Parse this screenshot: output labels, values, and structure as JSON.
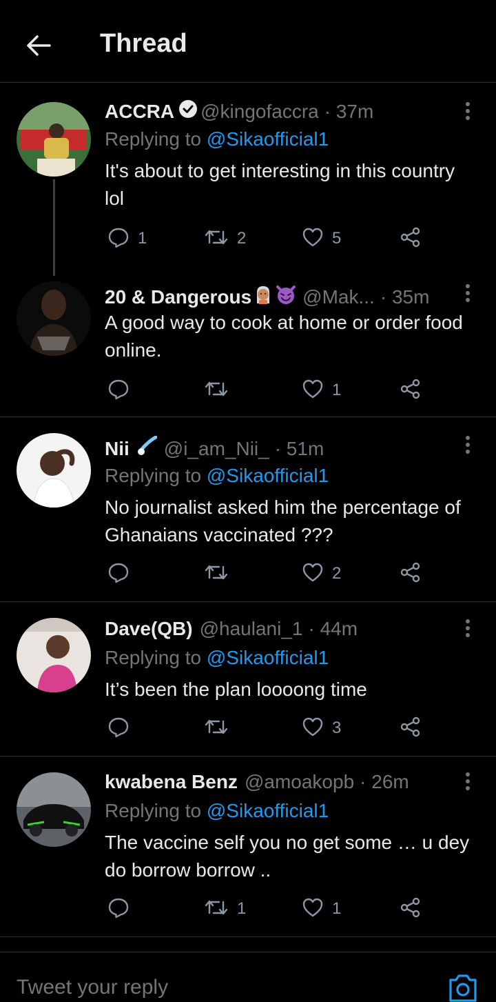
{
  "header": {
    "title": "Thread"
  },
  "tweets": [
    {
      "name": "ACCRA",
      "handle": "@kingofaccra",
      "time": "· 37m",
      "verified": true,
      "replying_prefix": "Replying to ",
      "replying_to": "@Sikaofficial1",
      "text": "It's about to get interesting in this country lol",
      "replies": "1",
      "retweets": "2",
      "likes": "5"
    },
    {
      "name": "20 & Dangerous",
      "handle": "@Mak...",
      "time": "· 35m",
      "text": "A good way to cook at home or order food online.",
      "replies": "",
      "retweets": "",
      "likes": "1"
    },
    {
      "name": "Nii",
      "handle": "@i_am_Nii_",
      "time": "· 51m",
      "replying_prefix": "Replying to ",
      "replying_to": "@Sikaofficial1",
      "text": "No journalist asked him the percentage of Ghanaians vaccinated ???",
      "replies": "",
      "retweets": "",
      "likes": "2"
    },
    {
      "name": "Dave(QB)",
      "handle": "@haulani_1",
      "time": "· 44m",
      "replying_prefix": "Replying to ",
      "replying_to": "@Sikaofficial1",
      "text": "It’s been the plan loooong time",
      "replies": "",
      "retweets": "",
      "likes": "3"
    },
    {
      "name": "kwabena Benz",
      "handle": "@amoakopb",
      "time": "· 26m",
      "replying_prefix": "Replying to ",
      "replying_to": "@Sikaofficial1",
      "text": "The vaccine self you no get some … u dey do borrow borrow ..",
      "replies": "",
      "retweets": "1",
      "likes": "1"
    }
  ],
  "compose": {
    "placeholder": "Tweet your reply"
  },
  "colors": {
    "link": "#1d9bf0",
    "muted": "#71767b",
    "background": "#000000"
  },
  "icons": [
    "back-arrow-icon",
    "verified-badge-icon",
    "reply-icon",
    "retweet-icon",
    "like-icon",
    "share-icon",
    "more-icon",
    "camera-icon"
  ]
}
